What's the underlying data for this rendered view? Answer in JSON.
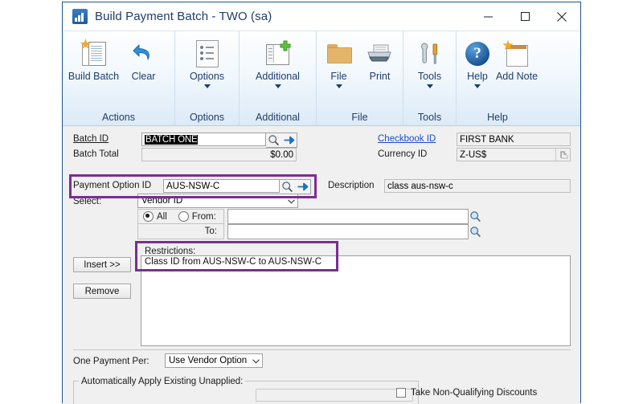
{
  "window": {
    "title": "Build Payment Batch  -  TWO (sa)",
    "app_icon": "chart-bars-icon",
    "controls": {
      "minimize": "minimize",
      "maximize": "maximize",
      "close": "close"
    }
  },
  "ribbon": {
    "groups": [
      {
        "title": "Actions",
        "items": [
          {
            "label": "Build Batch",
            "icon": "new-document-star-icon",
            "has_caret": false
          },
          {
            "label": "Clear",
            "icon": "undo-arrow-icon",
            "has_caret": false
          }
        ]
      },
      {
        "title": "Options",
        "items": [
          {
            "label": "Options",
            "icon": "bulleted-list-document-icon",
            "has_caret": true
          }
        ]
      },
      {
        "title": "Additional",
        "items": [
          {
            "label": "Additional",
            "icon": "window-plus-icon",
            "has_caret": true
          }
        ]
      },
      {
        "title": "File",
        "items": [
          {
            "label": "File",
            "icon": "folder-icon",
            "has_caret": true
          },
          {
            "label": "Print",
            "icon": "printer-icon",
            "has_caret": false
          }
        ]
      },
      {
        "title": "Tools",
        "items": [
          {
            "label": "Tools",
            "icon": "wrench-screwdriver-icon",
            "has_caret": true
          }
        ]
      },
      {
        "title": "Help",
        "items": [
          {
            "label": "Help",
            "icon": "help-question-circle-icon",
            "has_caret": true
          },
          {
            "label": "Add Note",
            "icon": "note-page-icon",
            "has_caret": false
          }
        ]
      }
    ]
  },
  "form": {
    "batch_id": {
      "label": "Batch ID",
      "value": "BATCH ONE",
      "selected": true
    },
    "batch_total": {
      "label": "Batch Total",
      "value": "$0.00"
    },
    "checkbook_id": {
      "label": "Checkbook ID",
      "value": "FIRST BANK"
    },
    "currency_id": {
      "label": "Currency ID",
      "value": "Z-US$"
    },
    "payment_option_id": {
      "label": "Payment Option ID",
      "value": "AUS-NSW-C"
    },
    "description": {
      "label": "Description",
      "value": "class aus-nsw-c"
    },
    "select": {
      "label": "Select:",
      "value": "Vendor ID"
    },
    "range": {
      "all_label": "All",
      "all_selected": true,
      "from_label": "From:",
      "from_value": "",
      "to_label": "To:",
      "to_value": ""
    },
    "restrictions": {
      "label": "Restrictions:",
      "items": [
        "Class ID from AUS-NSW-C to AUS-NSW-C"
      ]
    },
    "buttons": {
      "insert": "Insert >>",
      "remove": "Remove"
    },
    "one_payment_per": {
      "label": "One Payment Per:",
      "value": "Use Vendor Option"
    },
    "auto_apply": {
      "label": "Automatically Apply Existing Unapplied:",
      "value": ""
    },
    "take_discounts": {
      "label": "Take Non-Qualifying Discounts",
      "checked": false
    }
  },
  "icons": {
    "lookup": "magnifier-lookup-icon",
    "goto": "blue-right-arrow-icon",
    "expand": "expand-note-icon",
    "dropdown": "chevron-down-icon"
  },
  "colors": {
    "highlight_purple": "#7b2d93",
    "title_blue": "#1e3d6b",
    "link_blue": "#1a4fbf",
    "window_border": "#1c5592"
  }
}
